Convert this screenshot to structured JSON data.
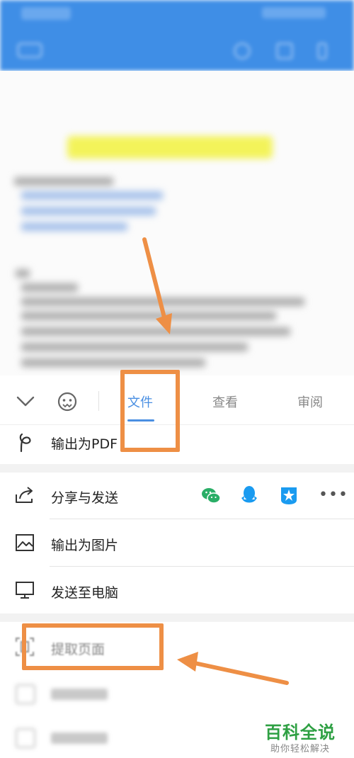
{
  "toolbar_tabs": [
    {
      "label": "文件",
      "active": true
    },
    {
      "label": "查看",
      "active": false
    },
    {
      "label": "审阅",
      "active": false
    }
  ],
  "menu": {
    "export_pdf": "输出为PDF",
    "share_send": "分享与发送",
    "share_targets": [
      "wechat-icon",
      "qq-icon",
      "tim-icon",
      "more-icon"
    ],
    "more_label": "•••",
    "export_image": "输出为图片",
    "send_to_pc": "发送至电脑",
    "extract_pages": "提取页面"
  },
  "colors": {
    "accent": "#4a8fe2",
    "annotation": "#ee8f45",
    "wechat": "#2aae67",
    "qq": "#1a9bf0",
    "watermark": "#2ea043"
  },
  "watermark": {
    "title": "百科全说",
    "subtitle": "助你轻松解决"
  }
}
